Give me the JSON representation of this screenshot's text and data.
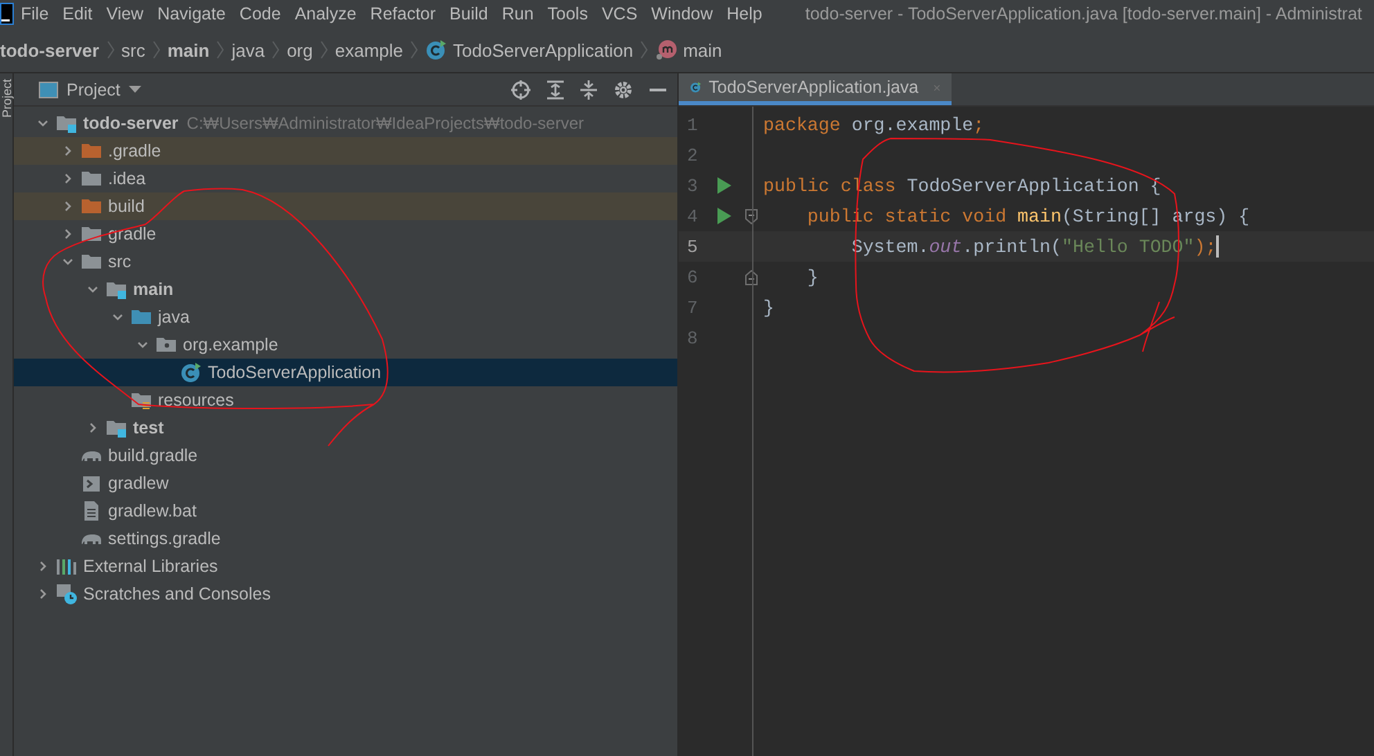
{
  "menu_bar": {
    "items": [
      "File",
      "Edit",
      "View",
      "Navigate",
      "Code",
      "Analyze",
      "Refactor",
      "Build",
      "Run",
      "Tools",
      "VCS",
      "Window",
      "Help"
    ],
    "title": "todo-server - TodoServerApplication.java [todo-server.main] - Administrat"
  },
  "breadcrumbs": [
    {
      "label": "todo-server",
      "kind": "bold"
    },
    {
      "label": "src",
      "kind": "plain"
    },
    {
      "label": "main",
      "kind": "bold"
    },
    {
      "label": "java",
      "kind": "plain"
    },
    {
      "label": "org",
      "kind": "plain"
    },
    {
      "label": "example",
      "kind": "plain"
    },
    {
      "label": "TodoServerApplication",
      "kind": "class"
    },
    {
      "label": "main",
      "kind": "method"
    }
  ],
  "side_strip": {
    "label": "Project"
  },
  "project_panel": {
    "title": "Project",
    "tree": [
      {
        "label": "todo-server",
        "path": "C:₩Users₩Administrator₩IdeaProjects₩todo-server",
        "kind": "module",
        "bold": true,
        "expanded": true,
        "selected": false,
        "children": [
          {
            "label": ".gradle",
            "kind": "excluded",
            "bold": false,
            "expanded": false,
            "selected": false
          },
          {
            "label": ".idea",
            "kind": "folder",
            "bold": false,
            "expanded": false,
            "selected": false
          },
          {
            "label": "build",
            "kind": "excluded",
            "bold": false,
            "expanded": false,
            "selected": false
          },
          {
            "label": "gradle",
            "kind": "folder",
            "bold": false,
            "expanded": false,
            "selected": false
          },
          {
            "label": "src",
            "kind": "folder",
            "bold": false,
            "expanded": true,
            "selected": false,
            "children": [
              {
                "label": "main",
                "kind": "module",
                "bold": true,
                "expanded": true,
                "selected": false,
                "children": [
                  {
                    "label": "java",
                    "kind": "source",
                    "bold": false,
                    "expanded": true,
                    "selected": false,
                    "children": [
                      {
                        "label": "org.example",
                        "kind": "package",
                        "bold": false,
                        "expanded": true,
                        "selected": false,
                        "children": [
                          {
                            "label": "TodoServerApplication",
                            "kind": "class",
                            "bold": false,
                            "selected": true
                          }
                        ]
                      }
                    ]
                  },
                  {
                    "label": "resources",
                    "kind": "resources",
                    "bold": false,
                    "selected": false
                  }
                ]
              },
              {
                "label": "test",
                "kind": "module",
                "bold": true,
                "expanded": false,
                "selected": false
              }
            ]
          },
          {
            "label": "build.gradle",
            "kind": "gradle",
            "bold": false,
            "selected": false
          },
          {
            "label": "gradlew",
            "kind": "script",
            "bold": false,
            "selected": false
          },
          {
            "label": "gradlew.bat",
            "kind": "text",
            "bold": false,
            "selected": false
          },
          {
            "label": "settings.gradle",
            "kind": "gradle",
            "bold": false,
            "selected": false
          }
        ]
      },
      {
        "label": "External Libraries",
        "kind": "libraries",
        "bold": false,
        "expanded": false,
        "selected": false
      },
      {
        "label": "Scratches and Consoles",
        "kind": "scratches",
        "bold": false,
        "expanded": false,
        "selected": false
      }
    ]
  },
  "editor": {
    "tabs": [
      {
        "label": "TodoServerApplication.java",
        "selected": true
      }
    ],
    "lines": [
      {
        "number": "1",
        "run": false,
        "fold_start": false,
        "fold_end": false,
        "current": false,
        "tokens": [
          {
            "text": "package ",
            "kind": "keyword"
          },
          {
            "text": "org.example",
            "kind": "plain"
          },
          {
            "text": ";",
            "kind": "keyword"
          }
        ]
      },
      {
        "number": "2",
        "run": false,
        "fold_start": false,
        "fold_end": false,
        "current": false
      },
      {
        "number": "3",
        "run": true,
        "fold_start": false,
        "fold_end": false,
        "current": false,
        "tokens": [
          {
            "text": "public class ",
            "kind": "keyword"
          },
          {
            "text": "TodoServerApplication {",
            "kind": "plain"
          }
        ]
      },
      {
        "number": "4",
        "run": true,
        "fold_start": true,
        "fold_end": false,
        "current": false,
        "tokens": [
          {
            "text": "    public static void ",
            "kind": "keyword"
          },
          {
            "text": "main",
            "kind": "method"
          },
          {
            "text": "(String[] args) {",
            "kind": "plain"
          }
        ]
      },
      {
        "number": "5",
        "run": false,
        "fold_start": false,
        "fold_end": false,
        "current": true,
        "tokens": [
          {
            "text": "        System.",
            "kind": "plain"
          },
          {
            "text": "out",
            "kind": "field"
          },
          {
            "text": ".println(",
            "kind": "plain"
          },
          {
            "text": "\"Hello TODO\"",
            "kind": "string"
          },
          {
            "text": ");",
            "kind": "plain_end"
          }
        ]
      },
      {
        "number": "6",
        "run": false,
        "fold_start": false,
        "fold_end": true,
        "current": false,
        "tokens": [
          {
            "text": "    }",
            "kind": "plain"
          }
        ]
      },
      {
        "number": "7",
        "run": false,
        "fold_start": false,
        "fold_end": false,
        "current": false,
        "tokens": [
          {
            "text": "}",
            "kind": "plain"
          }
        ]
      },
      {
        "number": "8",
        "run": false,
        "fold_start": false,
        "fold_end": false,
        "current": false
      }
    ]
  }
}
